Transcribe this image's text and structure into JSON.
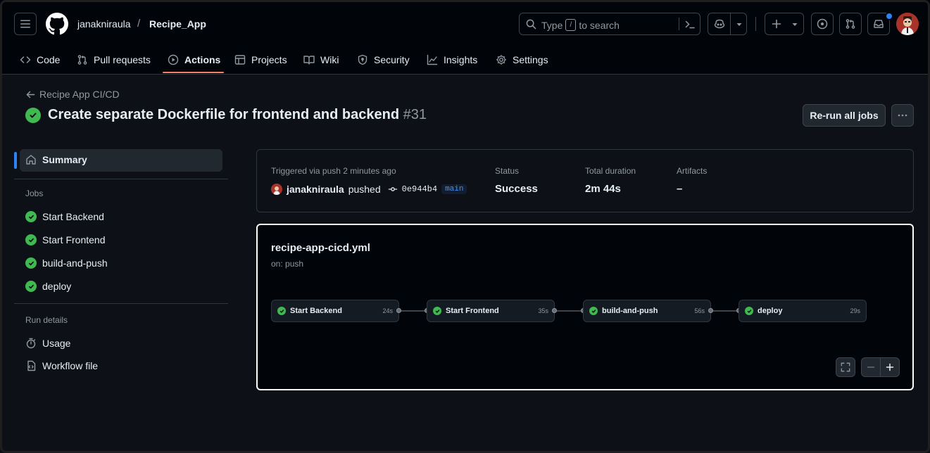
{
  "header": {
    "owner": "janakniraula",
    "separator": "/",
    "repo": "Recipe_App",
    "search": {
      "prefix": "Type",
      "key": "/",
      "suffix": "to search"
    }
  },
  "tabs": [
    {
      "label": "Code",
      "icon": "code-icon"
    },
    {
      "label": "Pull requests",
      "icon": "git-pull-request-icon"
    },
    {
      "label": "Actions",
      "icon": "play-icon",
      "active": true
    },
    {
      "label": "Projects",
      "icon": "table-icon"
    },
    {
      "label": "Wiki",
      "icon": "book-icon"
    },
    {
      "label": "Security",
      "icon": "shield-icon"
    },
    {
      "label": "Insights",
      "icon": "graph-icon"
    },
    {
      "label": "Settings",
      "icon": "gear-icon"
    }
  ],
  "run": {
    "back_label": "Recipe App CI/CD",
    "title": "Create separate Dockerfile for frontend and backend",
    "number": "#31",
    "rerun_label": "Re-run all jobs"
  },
  "sidebar": {
    "summary_label": "Summary",
    "jobs_heading": "Jobs",
    "jobs": [
      "Start Backend",
      "Start Frontend",
      "build-and-push",
      "deploy"
    ],
    "run_details_heading": "Run details",
    "usage_label": "Usage",
    "workflow_file_label": "Workflow file"
  },
  "summary": {
    "triggered_label": "Triggered via push 2 minutes ago",
    "actor": "janakniraula",
    "action": "pushed",
    "sha": "0e944b4",
    "branch": "main",
    "status_label": "Status",
    "status_value": "Success",
    "duration_label": "Total duration",
    "duration_value": "2m 44s",
    "artifacts_label": "Artifacts",
    "artifacts_value": "–"
  },
  "workflow": {
    "file": "recipe-app-cicd.yml",
    "trigger": "on: push",
    "jobs": [
      {
        "name": "Start Backend",
        "duration": "24s"
      },
      {
        "name": "Start Frontend",
        "duration": "35s"
      },
      {
        "name": "build-and-push",
        "duration": "56s"
      },
      {
        "name": "deploy",
        "duration": "29s"
      }
    ]
  },
  "colors": {
    "background": "#0d1117",
    "header": "#010409",
    "success": "#3fb950",
    "accent_underline": "#f78166",
    "link": "#4493f8",
    "notification_dot": "#2f81f7"
  }
}
